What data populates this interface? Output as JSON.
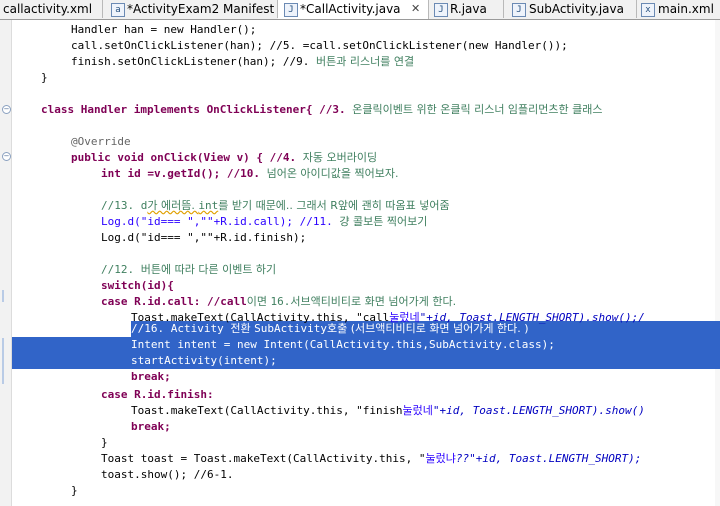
{
  "tabs": [
    {
      "label": "callactivity.xml",
      "icon": "xml-file-icon"
    },
    {
      "label": "*ActivityExam2 Manifest",
      "icon": "manifest-file-icon"
    },
    {
      "label": "*CallActivity.java",
      "icon": "java-file-icon",
      "close": "✕"
    },
    {
      "label": "R.java",
      "icon": "java-file-icon"
    },
    {
      "label": "SubActivity.java",
      "icon": "java-file-icon"
    },
    {
      "label": "main.xml",
      "icon": "xml-file-icon"
    }
  ],
  "code": {
    "l1": "Handler han = new Handler();",
    "l2": "call.setOnClickListener(han); //5. =call.setOnClickListener(new Handler());",
    "l3a": "finish.setOnClickListener(han); //9. ",
    "l3b": "버튼과 리스너를 연결",
    "l4": "}",
    "l5a": "class Handler implements OnClickListener{ //3. ",
    "l5b": "온클릭이벤트 위한 온클릭 리스너 임플리먼츠한 클래스",
    "l6": "@Override",
    "l7a": "public void onClick(View v) { //4. ",
    "l7b": "자동 오버라이딩",
    "l8a": "int id =v.getId(); //10. ",
    "l8b": "넘어온 아이디값을 찍어보자.",
    "l9a": "//13. d",
    "l9b": "가 에러뜸. ",
    "l9c": "int",
    "l9d": "를 받기 때문에.. 그래서 R",
    "l9e": "앞에 괜히 따옴표 넣어줌",
    "l10a": "Log.d(\"id=== \",\"\"+R.id.call); //11. ",
    "l10b": "걍 콜보튼 찍어보기",
    "l11": "Log.d(\"id=== \",\"\"+R.id.finish);",
    "l12a": "//12. ",
    "l12b": "버튼에 따라 다른 이벤트 하기",
    "l13": "switch(id){",
    "l14a": "case R.id.call: //call",
    "l14b": "이면 ",
    "l14c": "16.",
    "l14d": "서브액티비티로 화면 넘어가게 한다.",
    "l15a": "Toast.makeText(CallActivity.this, \"call",
    "l15b": "눌렀네",
    "l15c": "\"+id, Toast.LENGTH_SHORT).show();/",
    "l16a": "//16. Activity ",
    "l16b": "전환 ",
    "l16c": "SubActivity",
    "l16d": "호출 (서브액티비티로 화면 넘어가게 한다. )",
    "l17": "Intent intent = new Intent(CallActivity.this,SubActivity.class);",
    "l18": "startActivity(intent);",
    "l19": "break;",
    "l20": "case R.id.finish:",
    "l21a": "Toast.makeText(CallActivity.this, \"finish",
    "l21b": "눌렀네",
    "l21c": "\"+id, Toast.LENGTH_SHORT).show()",
    "l22": "break;",
    "l23": "}",
    "l24a": "Toast toast = Toast.makeText(CallActivity.this, \"",
    "l24b": "눌렀냐",
    "l24c": "??\"+id, Toast.LENGTH_SHORT);",
    "l25": "toast.show(); //6-1.",
    "l26": "}"
  },
  "colors": {
    "keyword": "#7f0055",
    "string": "#2a00ff",
    "comment": "#3f7f5f",
    "field": "#0000c0",
    "selection": "#3164c8"
  }
}
